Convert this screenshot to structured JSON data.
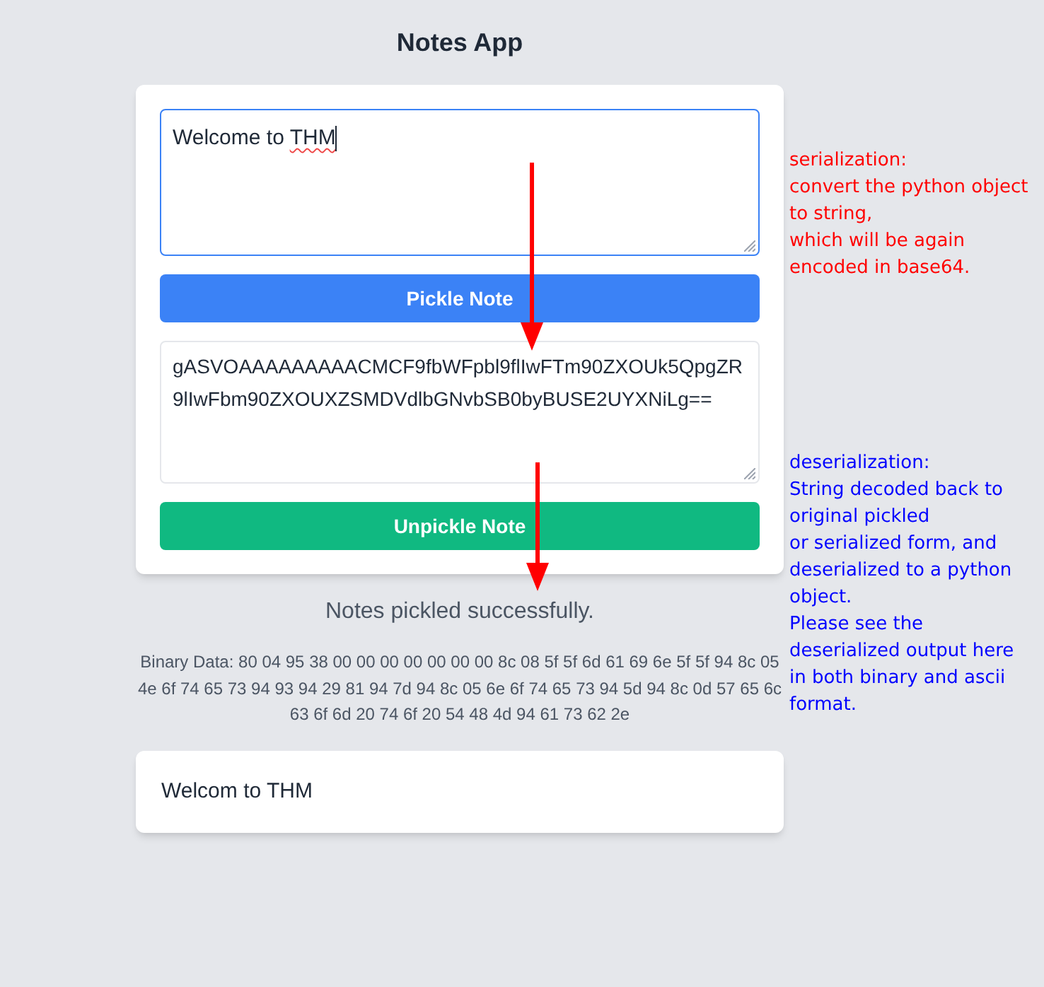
{
  "app": {
    "title": "Notes App"
  },
  "note_form": {
    "note_input": {
      "value": [
        {
          "text": "Welcome to ",
          "misspelled": false
        },
        {
          "text": "THM",
          "misspelled": true
        }
      ],
      "focused": true
    },
    "pickle_button": "Pickle Note",
    "pickled_output": {
      "value": "gASVOAAAAAAAAACMCF9fbWFpbl9flIwFTm90ZXOUk5QpgZR9lIwFbm90ZXOUXZSMDVdlbGNvbSB0byBUSE2UYXNiLg==",
      "focused": false
    },
    "unpickle_button": "Unpickle Note"
  },
  "status_message": "Notes pickled successfully.",
  "binary_data": "Binary Data: 80 04 95 38 00 00 00 00 00 00 00 8c 08 5f 5f 6d 61 69 6e 5f 5f 94 8c 05 4e 6f 74 65 73 94 93 94 29 81 94 7d 94 8c 05 6e 6f 74 65 73 94 5d 94 8c 0d 57 65 6c 63 6f 6d 20 74 6f 20 54 48 4d 94 61 73 62 2e",
  "unpickled_note": {
    "text": "Welcom to THM"
  },
  "annotations": [
    {
      "text": "serialization:\nconvert the python object to string,\nwhich will be again encoded in base64.",
      "color": "#ff0000"
    },
    {
      "text": "deserialization:\nString decoded back to original pickled\nor serialized form, and\ndeserialized to a python object.\nPlease see the deserialized output here\nin both binary and ascii format.",
      "color": "#0000ff"
    }
  ]
}
